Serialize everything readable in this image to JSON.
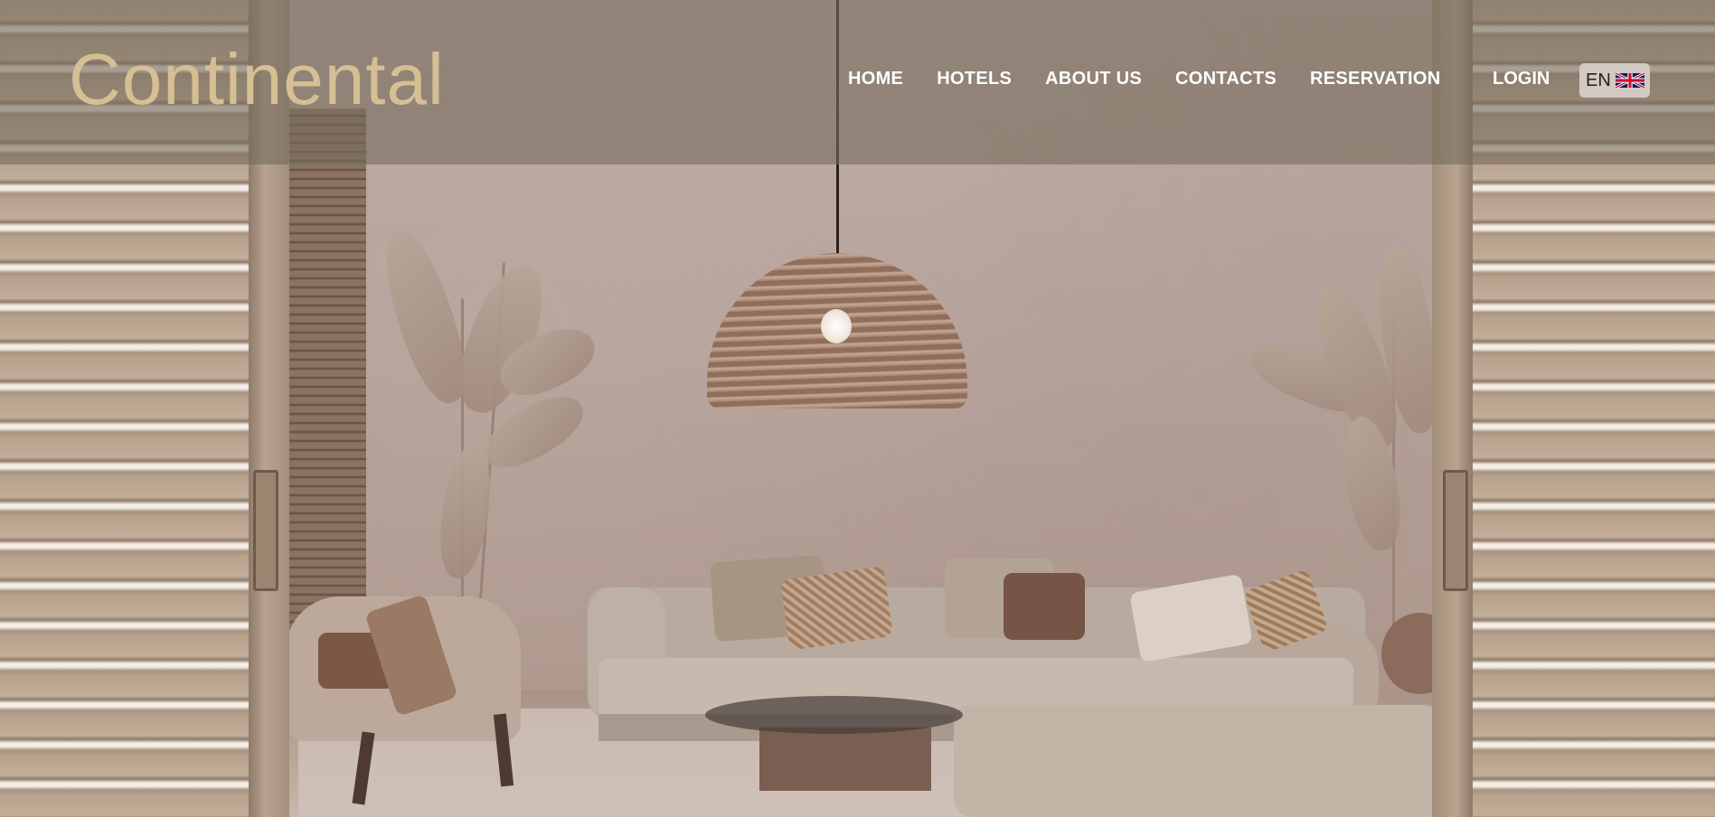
{
  "brand": {
    "logo_text": "Continental",
    "logo_color": "#d6bf94"
  },
  "nav": {
    "items": [
      {
        "label": "HOME"
      },
      {
        "label": "HOTELS"
      },
      {
        "label": "ABOUT US"
      },
      {
        "label": "CONTACTS"
      },
      {
        "label": "RESERVATION"
      }
    ],
    "login_label": "LOGIN",
    "language": {
      "code": "EN",
      "flag_icon": "uk-flag-icon"
    }
  },
  "hero": {
    "image_subject": "living-room-with-rattan-pendant-lamp",
    "colors": {
      "wall": "#b6a29a",
      "overlay": "#746b5c",
      "wood": "#b7a28d"
    }
  }
}
